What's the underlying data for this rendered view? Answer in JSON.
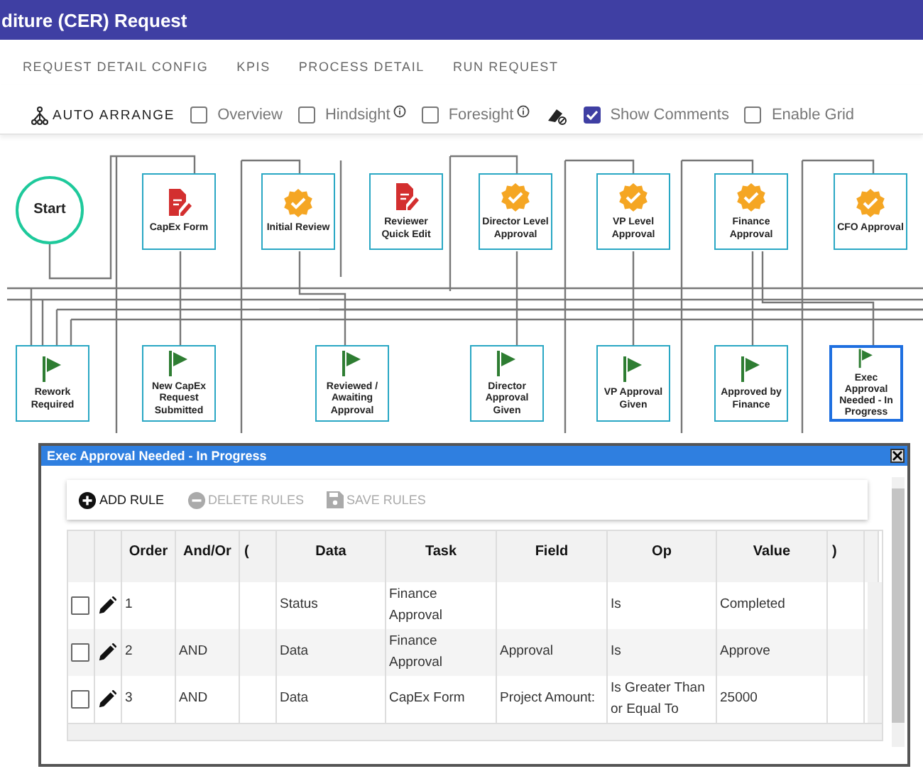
{
  "header": {
    "title": "diture (CER) Request"
  },
  "tabs": [
    {
      "label": "REQUEST DETAIL CONFIG",
      "selected": false
    },
    {
      "label": "KPIS",
      "selected": false
    },
    {
      "label": "PROCESS DETAIL",
      "selected": false
    },
    {
      "label": "RUN REQUEST",
      "selected": false
    }
  ],
  "toolbar": {
    "auto_arrange": "AUTO ARRANGE",
    "options": [
      {
        "label": "Overview",
        "checked": false,
        "info": false
      },
      {
        "label": "Hindsight",
        "checked": false,
        "info": true
      },
      {
        "label": "Foresight",
        "checked": false,
        "info": true
      },
      {
        "label": "Show Comments",
        "checked": true,
        "info": false
      },
      {
        "label": "Enable Grid",
        "checked": false,
        "info": false
      }
    ]
  },
  "nodes": [
    {
      "kind": "start",
      "label": "Start",
      "selected": false
    },
    {
      "kind": "form",
      "label": "CapEx Form",
      "selected": false
    },
    {
      "kind": "approval",
      "label": "Initial Review",
      "selected": false
    },
    {
      "kind": "form",
      "label": "Reviewer Quick Edit",
      "selected": false
    },
    {
      "kind": "approval",
      "label": "Director Level Approval",
      "selected": false
    },
    {
      "kind": "approval",
      "label": "VP Level Approval",
      "selected": false
    },
    {
      "kind": "approval",
      "label": "Finance Approval",
      "selected": false
    },
    {
      "kind": "approval",
      "label": "CFO Approval",
      "selected": false
    },
    {
      "kind": "status",
      "label": "Rework Required",
      "selected": false
    },
    {
      "kind": "status",
      "label": "New CapEx Request Submitted",
      "selected": false
    },
    {
      "kind": "status",
      "label": "Reviewed / Awaiting Approval",
      "selected": false
    },
    {
      "kind": "status",
      "label": "Director Approval Given",
      "selected": false
    },
    {
      "kind": "status",
      "label": "VP Approval Given",
      "selected": false
    },
    {
      "kind": "status",
      "label": "Approved by Finance",
      "selected": false
    },
    {
      "kind": "status",
      "label": "Exec Approval Needed - In Progress",
      "selected": true
    }
  ],
  "dialog": {
    "title": "Exec Approval Needed - In Progress",
    "actions": [
      {
        "kind": "add",
        "label": "ADD RULE",
        "disabled": false
      },
      {
        "kind": "delete",
        "label": "DELETE RULES",
        "disabled": true
      },
      {
        "kind": "save",
        "label": "SAVE RULES",
        "disabled": true
      }
    ],
    "columns": [
      "Order",
      "And/Or",
      "(",
      "Data",
      "Task",
      "Field",
      "Op",
      "Value",
      ")"
    ],
    "rows": [
      {
        "checked": false,
        "cells": [
          "1",
          "",
          "",
          "Status",
          "Finance Approval",
          "",
          "Is",
          "Completed",
          ""
        ]
      },
      {
        "checked": false,
        "cells": [
          "2",
          "AND",
          "",
          "Data",
          "Finance Approval",
          "Approval",
          "Is",
          "Approve",
          ""
        ]
      },
      {
        "checked": false,
        "cells": [
          "3",
          "AND",
          "",
          "Data",
          "CapEx Form",
          "Project Amount:",
          "Is Greater Than or Equal To",
          "25000",
          ""
        ]
      }
    ]
  }
}
